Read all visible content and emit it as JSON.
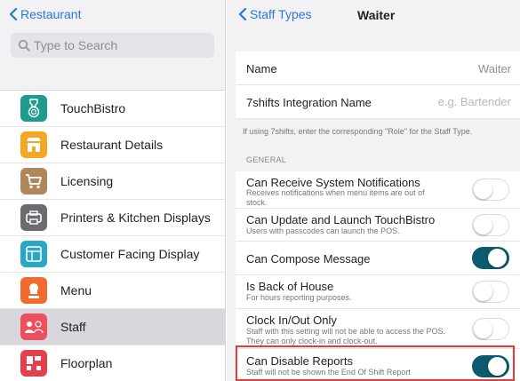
{
  "left": {
    "back_label": "Restaurant",
    "search": {
      "placeholder": "Type to Search"
    },
    "items": [
      {
        "label": "TouchBistro",
        "icon": "touchbistro-logo-icon",
        "color": "#1f9b8e"
      },
      {
        "label": "Restaurant Details",
        "icon": "store-icon",
        "color": "#f5a623"
      },
      {
        "label": "Licensing",
        "icon": "cart-icon",
        "color": "#b0875a"
      },
      {
        "label": "Printers & Kitchen Displays",
        "icon": "printer-icon",
        "color": "#6b6b70"
      },
      {
        "label": "Customer Facing Display",
        "icon": "display-icon",
        "color": "#2aa7c2"
      },
      {
        "label": "Menu",
        "icon": "chef-icon",
        "color": "#f26a2e"
      },
      {
        "label": "Staff",
        "icon": "staff-icon",
        "color": "#ee4f5f",
        "selected": true
      },
      {
        "label": "Floorplan",
        "icon": "floorplan-icon",
        "color": "#e5404e"
      }
    ]
  },
  "right": {
    "back_label": "Staff Types",
    "title": "Waiter",
    "name_row": {
      "label": "Name",
      "value": "Waiter"
    },
    "integration_row": {
      "label": "7shifts Integration Name",
      "placeholder": "e.g. Bartender"
    },
    "note": "If using 7shifts, enter the corresponding \"Role\" for the Staff Type.",
    "section_header": "GENERAL",
    "settings": [
      {
        "label": "Can Receive System Notifications",
        "desc": "Receives notifications when menu items are out of stock.",
        "on": false
      },
      {
        "label": "Can Update and Launch TouchBistro",
        "desc": "Users with passcodes can launch the POS.",
        "on": false
      },
      {
        "label": "Can Compose Message",
        "desc": "",
        "on": true
      },
      {
        "label": "Is Back of House",
        "desc": "For hours reporting purposes.",
        "on": false
      },
      {
        "label": "Clock In/Out Only",
        "desc": "Staff with this setting will not be able to access the POS. They can only clock-in and clock-out.",
        "on": false
      },
      {
        "label": "Can Disable Reports",
        "desc": "Staff will not be shown the End Of Shift Report",
        "on": true
      }
    ]
  },
  "colors": {
    "accent": "#2a77d6",
    "toggle_on": "#0b5a6e",
    "highlight": "#e43a3a"
  }
}
